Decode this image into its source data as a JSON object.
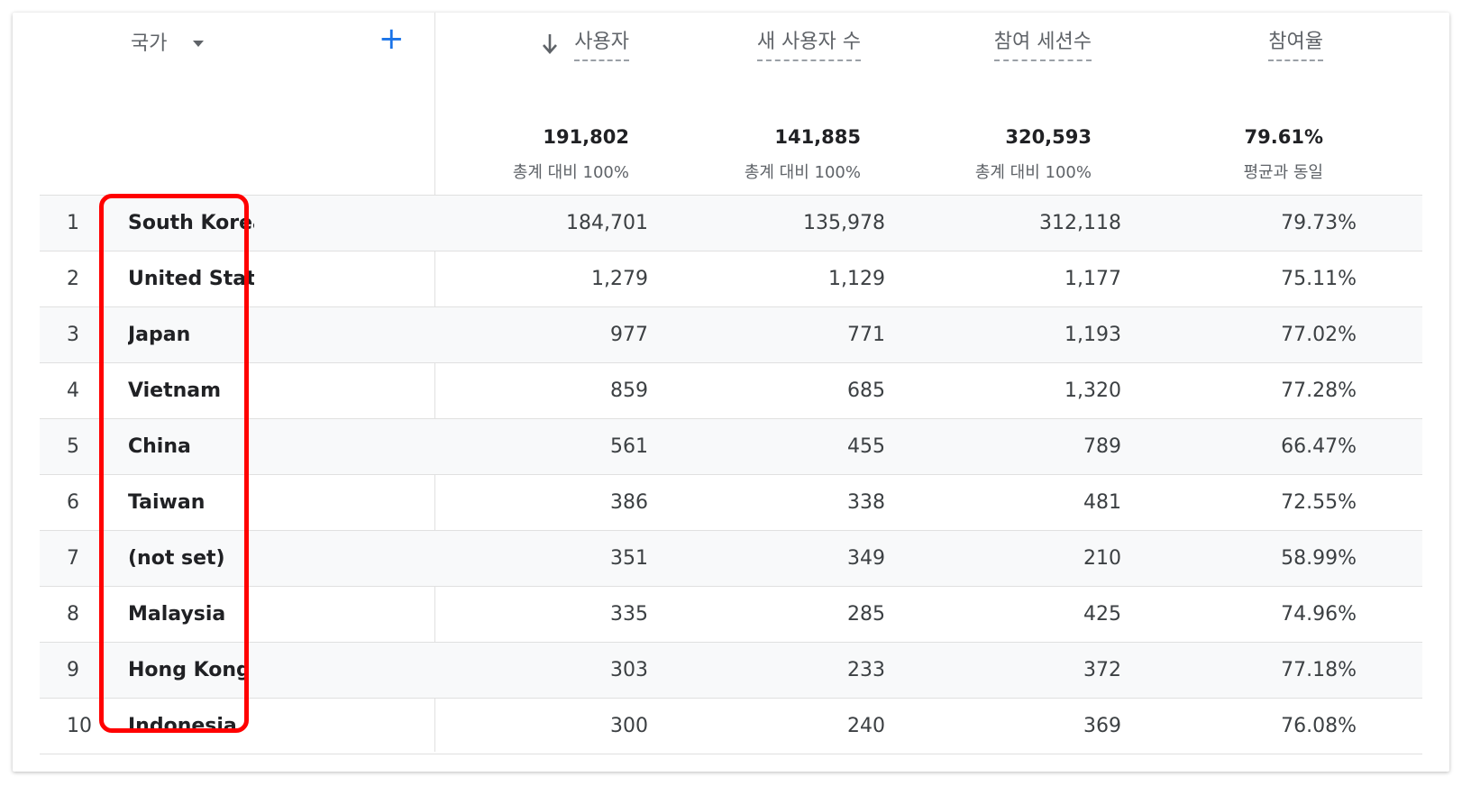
{
  "table": {
    "dimension": {
      "label": "국가",
      "dropdown_icon": "caret-down-icon",
      "add_icon": "plus-icon",
      "add_label": "+"
    },
    "columns": [
      {
        "label": "사용자",
        "sorted": "descending",
        "total": "191,802",
        "total_sub": "총계 대비 100%"
      },
      {
        "label": "새 사용자 수",
        "total": "141,885",
        "total_sub": "총계 대비 100%"
      },
      {
        "label": "참여 세션수",
        "total": "320,593",
        "total_sub": "총계 대비 100%"
      },
      {
        "label": "참여율",
        "total": "79.61%",
        "total_sub": "평균과 동일"
      }
    ],
    "rows": [
      {
        "rank": "1",
        "country": "South Korea",
        "values": [
          "184,701",
          "135,978",
          "312,118",
          "79.73%"
        ]
      },
      {
        "rank": "2",
        "country": "United States",
        "values": [
          "1,279",
          "1,129",
          "1,177",
          "75.11%"
        ]
      },
      {
        "rank": "3",
        "country": "Japan",
        "values": [
          "977",
          "771",
          "1,193",
          "77.02%"
        ]
      },
      {
        "rank": "4",
        "country": "Vietnam",
        "values": [
          "859",
          "685",
          "1,320",
          "77.28%"
        ]
      },
      {
        "rank": "5",
        "country": "China",
        "values": [
          "561",
          "455",
          "789",
          "66.47%"
        ]
      },
      {
        "rank": "6",
        "country": "Taiwan",
        "values": [
          "386",
          "338",
          "481",
          "72.55%"
        ]
      },
      {
        "rank": "7",
        "country": "(not set)",
        "values": [
          "351",
          "349",
          "210",
          "58.99%"
        ]
      },
      {
        "rank": "8",
        "country": "Malaysia",
        "values": [
          "335",
          "285",
          "425",
          "74.96%"
        ]
      },
      {
        "rank": "9",
        "country": "Hong Kong",
        "values": [
          "303",
          "233",
          "372",
          "77.18%"
        ]
      },
      {
        "rank": "10",
        "country": "Indonesia",
        "values": [
          "300",
          "240",
          "369",
          "76.08%"
        ]
      }
    ]
  },
  "colors": {
    "accent": "#1a73e8",
    "highlight": "#ff0000",
    "row_alt": "#f8f9fa",
    "border": "#e0e0e0"
  }
}
